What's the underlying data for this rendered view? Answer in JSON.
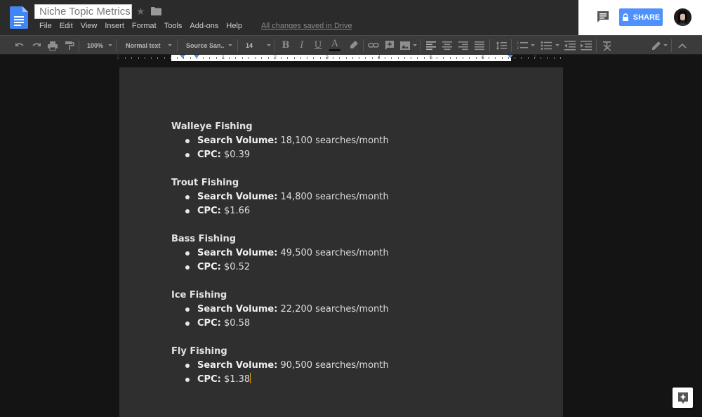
{
  "header": {
    "doc_title": "Niche Topic Metrics",
    "saved_status": "All changes saved in Drive",
    "share_label": "SHARE",
    "menu": [
      "File",
      "Edit",
      "View",
      "Insert",
      "Format",
      "Tools",
      "Add-ons",
      "Help"
    ]
  },
  "toolbar": {
    "zoom": "100%",
    "style": "Normal text",
    "font": "Source San..",
    "size": "14"
  },
  "ruler": {
    "numbers": [
      "1",
      "1",
      "2",
      "3",
      "4",
      "5",
      "6",
      "7"
    ]
  },
  "document": {
    "sections": [
      {
        "heading": "Walleye Fishing",
        "volume_label": "Search Volume:",
        "volume": " 18,100 searches/month",
        "cpc_label": "CPC:",
        "cpc": " $0.39"
      },
      {
        "heading": "Trout Fishing",
        "volume_label": "Search Volume:",
        "volume": " 14,800 searches/month",
        "cpc_label": "CPC:",
        "cpc": " $1.66"
      },
      {
        "heading": "Bass Fishing",
        "volume_label": "Search Volume:",
        "volume": " 49,500 searches/month",
        "cpc_label": "CPC:",
        "cpc": " $0.52"
      },
      {
        "heading": "Ice Fishing",
        "volume_label": "Search Volume:",
        "volume": " 22,200 searches/month",
        "cpc_label": "CPC:",
        "cpc": " $0.58"
      },
      {
        "heading": "Fly Fishing",
        "volume_label": "Search Volume:",
        "volume": " 90,500 searches/month",
        "cpc_label": "CPC:",
        "cpc": " $1.38"
      }
    ]
  },
  "colors": {
    "share_blue": "#4d90fe",
    "page_bg": "#2f2f2f",
    "cursor": "#f0a400"
  },
  "icons": {
    "app": "docs-icon",
    "star": "star-icon",
    "folder": "folder-icon",
    "comments": "comments-icon",
    "explore": "explore-icon"
  }
}
